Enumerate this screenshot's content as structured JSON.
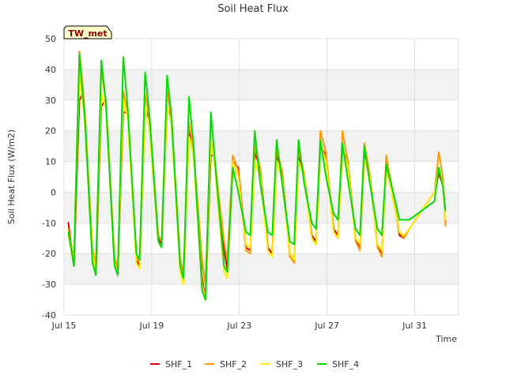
{
  "chart_data": {
    "type": "line",
    "title": "Soil Heat Flux",
    "xlabel": "Time",
    "ylabel": "Soil Heat Flux (W/m2)",
    "badge": "TW_met",
    "xlim": [
      0,
      18
    ],
    "ylim": [
      -40,
      50
    ],
    "x_ticks": [
      {
        "x": 0,
        "label": "Jul 15"
      },
      {
        "x": 4,
        "label": "Jul 19"
      },
      {
        "x": 8,
        "label": "Jul 23"
      },
      {
        "x": 12,
        "label": "Jul 27"
      },
      {
        "x": 16,
        "label": "Jul 31"
      }
    ],
    "y_ticks": [
      -40,
      -30,
      -20,
      -10,
      0,
      10,
      20,
      30,
      40,
      50
    ],
    "grid": true,
    "legend_position": "bottom",
    "series": [
      {
        "name": "SHF_1",
        "color": "#dd0000",
        "x": [
          0.2,
          0.45,
          0.7,
          0.85,
          0.95,
          1.3,
          1.45,
          1.7,
          1.9,
          2.3,
          2.45,
          2.7,
          2.9,
          3.3,
          3.45,
          3.7,
          3.9,
          4.3,
          4.45,
          4.7,
          4.9,
          5.3,
          5.45,
          5.7,
          5.9,
          6.3,
          6.45,
          6.7,
          6.85,
          7.3,
          7.45,
          7.7,
          7.95,
          8.3,
          8.5,
          8.7,
          8.95,
          9.3,
          9.5,
          9.7,
          9.95,
          10.3,
          10.5,
          10.7,
          10.95,
          11.3,
          11.5,
          11.7,
          11.95,
          12.3,
          12.5,
          12.7,
          12.95,
          13.3,
          13.5,
          13.7,
          13.95,
          14.3,
          14.5,
          14.7,
          14.95,
          15.3,
          15.5,
          15.75,
          16.9,
          17.1,
          17.3,
          17.4
        ],
        "y": [
          -10,
          -24,
          30,
          32,
          24,
          -20,
          -27,
          28,
          30,
          -22,
          -27,
          26,
          26,
          -22,
          -24,
          27,
          24,
          -15,
          -17,
          27,
          25,
          -25,
          -28,
          20,
          15,
          -28,
          -35,
          12,
          12,
          -19,
          -25,
          10,
          8,
          -18,
          -19,
          13,
          8,
          -18,
          -20,
          12,
          7,
          -20,
          -22,
          12,
          6,
          -14,
          -16,
          15,
          12,
          -12,
          -14,
          14,
          10,
          -15,
          -18,
          12,
          6,
          -17,
          -20,
          10,
          2,
          -14,
          -15,
          -12,
          0,
          6,
          2,
          -10
        ]
      },
      {
        "name": "SHF_2",
        "color": "#ff9900",
        "x": [
          0.2,
          0.45,
          0.7,
          0.85,
          0.95,
          1.3,
          1.45,
          1.7,
          1.9,
          2.3,
          2.45,
          2.7,
          2.9,
          3.3,
          3.45,
          3.7,
          3.9,
          4.3,
          4.45,
          4.7,
          4.9,
          5.3,
          5.45,
          5.7,
          5.9,
          6.3,
          6.45,
          6.7,
          6.85,
          7.3,
          7.45,
          7.7,
          7.95,
          8.3,
          8.5,
          8.7,
          8.95,
          9.3,
          9.5,
          9.7,
          9.95,
          10.3,
          10.5,
          10.7,
          10.95,
          11.3,
          11.5,
          11.7,
          11.95,
          12.3,
          12.5,
          12.7,
          12.95,
          13.3,
          13.5,
          13.7,
          13.95,
          14.3,
          14.5,
          14.7,
          14.95,
          15.3,
          15.5,
          15.75,
          16.9,
          17.1,
          17.3,
          17.4
        ],
        "y": [
          -12,
          -22,
          46,
          35,
          26,
          -18,
          -24,
          40,
          30,
          -21,
          -25,
          33,
          26,
          -20,
          -23,
          32,
          24,
          -14,
          -16,
          33,
          24,
          -22,
          -26,
          23,
          14,
          -22,
          -30,
          16,
          12,
          -16,
          -22,
          12,
          7,
          -19,
          -20,
          15,
          8,
          -19,
          -21,
          14,
          7,
          -21,
          -23,
          14,
          6,
          -15,
          -17,
          20,
          13,
          -13,
          -15,
          20,
          10,
          -16,
          -19,
          16,
          6,
          -18,
          -21,
          12,
          2,
          -13,
          -15,
          -12,
          0,
          13,
          4,
          -11
        ]
      },
      {
        "name": "SHF_3",
        "color": "#ffee00",
        "x": [
          0.2,
          0.45,
          0.7,
          0.85,
          0.95,
          1.3,
          1.45,
          1.7,
          1.9,
          2.3,
          2.45,
          2.7,
          2.9,
          3.3,
          3.45,
          3.7,
          3.9,
          4.3,
          4.45,
          4.7,
          4.9,
          5.3,
          5.45,
          5.7,
          5.9,
          6.3,
          6.45,
          6.7,
          6.85,
          7.3,
          7.45,
          7.7,
          7.95,
          8.3,
          8.5,
          8.7,
          8.95,
          9.3,
          9.5,
          9.7,
          9.95,
          10.3,
          10.5,
          10.7,
          10.95,
          11.3,
          11.5,
          11.7,
          11.95,
          12.3,
          12.5,
          12.7,
          12.95,
          13.3,
          13.5,
          13.7,
          13.95,
          14.3,
          14.5,
          14.7,
          14.95,
          15.3,
          15.5,
          15.75,
          16.9,
          17.1,
          17.3,
          17.4
        ],
        "y": [
          -14,
          -23,
          38,
          30,
          22,
          -20,
          -26,
          32,
          28,
          -23,
          -27,
          30,
          24,
          -23,
          -25,
          28,
          20,
          -16,
          -18,
          28,
          22,
          -26,
          -30,
          18,
          12,
          -30,
          -35,
          17,
          10,
          -26,
          -28,
          10,
          5,
          -17,
          -18,
          10,
          5,
          -19,
          -21,
          10,
          4,
          -20,
          -22,
          10,
          5,
          -15,
          -17,
          16,
          10,
          -13,
          -15,
          15,
          8,
          -15,
          -17,
          11,
          5,
          -17,
          -19,
          8,
          0,
          -13,
          -14,
          -12,
          0,
          8,
          2,
          -9
        ]
      },
      {
        "name": "SHF_4",
        "color": "#00dd00",
        "x": [
          0.2,
          0.45,
          0.7,
          0.85,
          0.95,
          1.3,
          1.45,
          1.7,
          1.9,
          2.3,
          2.45,
          2.7,
          2.9,
          3.3,
          3.45,
          3.7,
          3.9,
          4.3,
          4.45,
          4.7,
          4.9,
          5.3,
          5.45,
          5.7,
          5.9,
          6.3,
          6.45,
          6.7,
          6.85,
          7.3,
          7.45,
          7.7,
          7.95,
          8.3,
          8.5,
          8.7,
          8.95,
          9.3,
          9.5,
          9.7,
          9.95,
          10.3,
          10.5,
          10.7,
          10.95,
          11.3,
          11.5,
          11.7,
          11.95,
          12.3,
          12.5,
          12.7,
          12.95,
          13.3,
          13.5,
          13.7,
          13.95,
          14.3,
          14.5,
          14.7,
          14.95,
          15.3,
          15.5,
          15.75,
          16.9,
          17.1,
          17.3,
          17.4
        ],
        "y": [
          -13,
          -24,
          45,
          32,
          24,
          -23,
          -27,
          43,
          30,
          -24,
          -27,
          44,
          28,
          -20,
          -22,
          39,
          25,
          -16,
          -18,
          38,
          25,
          -24,
          -28,
          31,
          16,
          -32,
          -35,
          26,
          13,
          -24,
          -26,
          8,
          0,
          -13,
          -14,
          20,
          3,
          -13,
          -14,
          17,
          3,
          -16,
          -17,
          17,
          3,
          -10,
          -12,
          17,
          5,
          -7,
          -9,
          16,
          4,
          -12,
          -14,
          15,
          3,
          -12,
          -14,
          9,
          2,
          -9,
          -9,
          -9,
          -3,
          8,
          1,
          -6
        ]
      }
    ]
  }
}
